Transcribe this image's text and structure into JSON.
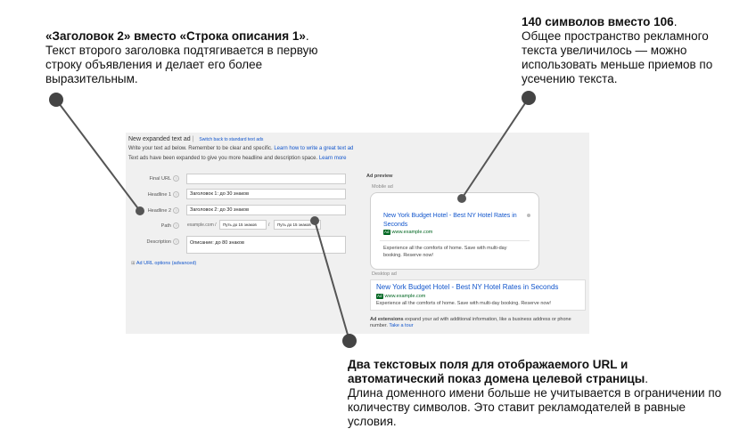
{
  "annotations": {
    "top_left": {
      "bold": "«Заголовок 2» вместо «Строка описания 1»",
      "rest": "Текст второго заголовка подтягивается в первую строку объявления и делает его более выразительным."
    },
    "top_right": {
      "bold": "140 символов вместо 106",
      "rest": "Общее пространство рекламного текста увеличилось — можно использовать меньше приемов по усечению текста."
    },
    "bottom": {
      "bold": "Два текстовых поля для отображаемого URL и автоматический показ домена целевой страницы",
      "rest": "Длина доменного имени больше не учитывается в ограничении по количеству символов. Это ставит рекламодателей в равные условия."
    }
  },
  "panel": {
    "title": "New expanded text ad",
    "switch_link": "Switch back to standard text ads",
    "instructions": "Write your text ad below. Remember to be clear and specific.",
    "instructions_link": "Learn how to write a great text ad",
    "expanded_note": "Text ads have been expanded to give you more headline and description space.",
    "learn_more": "Learn more",
    "form": {
      "final_url_label": "Final URL",
      "final_url_value": "",
      "headline1_label": "Headline 1",
      "headline1_value": "Заголовок 1: до 30 знаков",
      "headline2_label": "Headline 2",
      "headline2_value": "Заголовок 2: до 30 знаков",
      "path_label": "Path",
      "path_domain": "example.com /",
      "path1_value": "Путь до 15 знаков",
      "path_sep": "/",
      "path2_value": "Путь до 15 знаков",
      "description_label": "Description",
      "description_value": "Описание: до 80 знаков",
      "url_options": "Ad URL options (advanced)"
    },
    "preview": {
      "label": "Ad preview",
      "mobile_label": "Mobile ad",
      "desktop_label": "Desktop ad",
      "ad_title": "New York Budget Hotel - Best NY Hotel Rates in Seconds",
      "ad_badge": "Ad",
      "ad_url": "www.example.com",
      "ad_desc": "Experience all the comforts of home. Save with multi-day booking. Reserve now!",
      "extensions_bold": "Ad extensions",
      "extensions_text": "expand your ad with additional information, like a business address or phone number.",
      "tour_link": "Take a tour"
    }
  }
}
